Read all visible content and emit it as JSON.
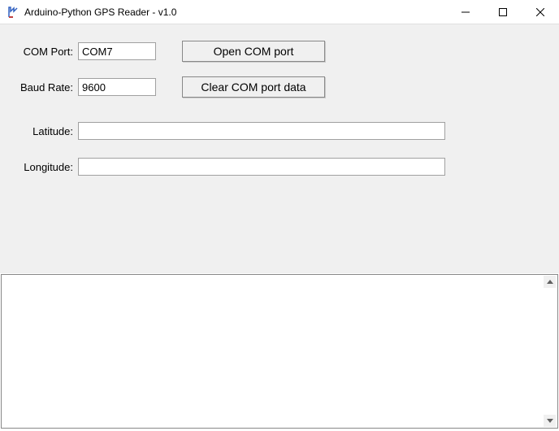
{
  "window": {
    "title": "Arduino-Python GPS Reader - v1.0"
  },
  "form": {
    "com_port_label": "COM Port:",
    "com_port_value": "COM7",
    "baud_rate_label": "Baud Rate:",
    "baud_rate_value": "9600",
    "latitude_label": "Latitude:",
    "latitude_value": "",
    "longitude_label": "Longitude:",
    "longitude_value": ""
  },
  "buttons": {
    "open_com": "Open COM port",
    "clear_com": "Clear COM port data"
  },
  "output": {
    "text": ""
  }
}
